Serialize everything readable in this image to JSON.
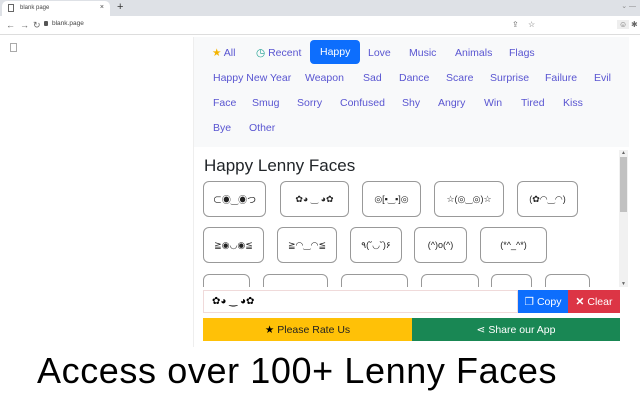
{
  "browser": {
    "tab_title": "blank page",
    "url": "blank.page",
    "new_tab": "+",
    "close": "×"
  },
  "categories": [
    {
      "label": "All",
      "icon": "star-icon"
    },
    {
      "label": "Recent",
      "icon": "clock-icon"
    },
    {
      "label": "Happy",
      "active": true
    },
    {
      "label": "Love"
    },
    {
      "label": "Music"
    },
    {
      "label": "Animals"
    },
    {
      "label": "Flags"
    },
    {
      "label": "Happy New Year"
    },
    {
      "label": "Weapon"
    },
    {
      "label": "Sad"
    },
    {
      "label": "Dance"
    },
    {
      "label": "Scare"
    },
    {
      "label": "Surprise"
    },
    {
      "label": "Failure"
    },
    {
      "label": "Evil"
    },
    {
      "label": "Face"
    },
    {
      "label": "Smug"
    },
    {
      "label": "Sorry"
    },
    {
      "label": "Confused"
    },
    {
      "label": "Shy"
    },
    {
      "label": "Angry"
    },
    {
      "label": "Win"
    },
    {
      "label": "Tired"
    },
    {
      "label": "Kiss"
    },
    {
      "label": "Bye"
    },
    {
      "label": "Other"
    }
  ],
  "section_title": "Happy Lenny Faces",
  "faces": [
    "⊂◉‿◉つ",
    "✿◕ ‿ ◕✿",
    "◎[▪‿▪]◎",
    "☆(◎‿◎)☆",
    "(✿◠‿◠)",
    "≧◉◡◉≦",
    "≧◠‿◠≦",
    "٩(˘◡˘)۶",
    "(^)o(^)",
    "(*^_^*)"
  ],
  "input_value": "✿◕ ‿ ◕✿",
  "buttons": {
    "copy": "Copy",
    "clear": "Clear",
    "rate": "Please Rate Us",
    "share": "Share our App"
  },
  "colors": {
    "primary": "#0d6efd",
    "danger": "#dc3545",
    "warning": "#ffc107",
    "success": "#198754"
  },
  "caption": "Access over 100+ Lenny Faces"
}
